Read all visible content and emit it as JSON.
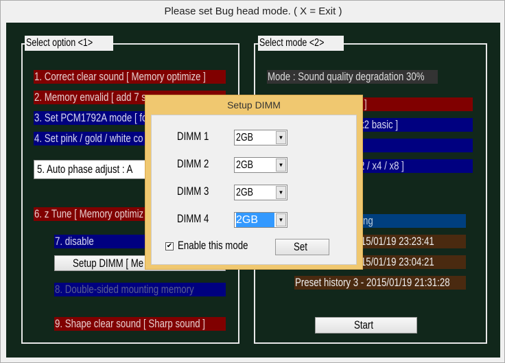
{
  "window": {
    "title": "Please set Bug head mode.  ( X = Exit )"
  },
  "left": {
    "label": "Select option <1>",
    "items": [
      "1. Correct clear sound [ Memory optimize ]",
      "2. Memory envalid [ add 7 s",
      "3. Set PCM1792A mode [ fo",
      "4. Set pink / gold / white co"
    ],
    "auto_phase": "5. Auto phase adjust : A",
    "ztune": "6. z Tune [ Memory optimiz",
    "disable": "7. disable",
    "setup_dimm": "Setup DIMM [ Me",
    "double_sided": "8. Double-sided mounting memory",
    "shape": "9. Shape clear sound [ Sharp sound ]"
  },
  "right": {
    "label": "Select mode <2>",
    "mode": "Mode : Sound quality degradation 30%",
    "items": [
      "]",
      "x2 basic ]",
      "",
      "2 / x4 / x8 ]"
    ],
    "status": "ng",
    "history": [
      " -  2015/01/19 23:23:41",
      " -  2015/01/19 23:04:21",
      "Preset history 3 -  2015/01/19 21:31:28"
    ],
    "start": "Start"
  },
  "dialog": {
    "title": "Setup DIMM",
    "dimms": [
      {
        "label": "DIMM 1",
        "value": "2GB"
      },
      {
        "label": "DIMM 2",
        "value": "2GB"
      },
      {
        "label": "DIMM 3",
        "value": "2GB"
      },
      {
        "label": "DIMM 4",
        "value": "2GB"
      }
    ],
    "enable_label": "Enable this mode",
    "enable_checked": true,
    "set": "Set"
  }
}
